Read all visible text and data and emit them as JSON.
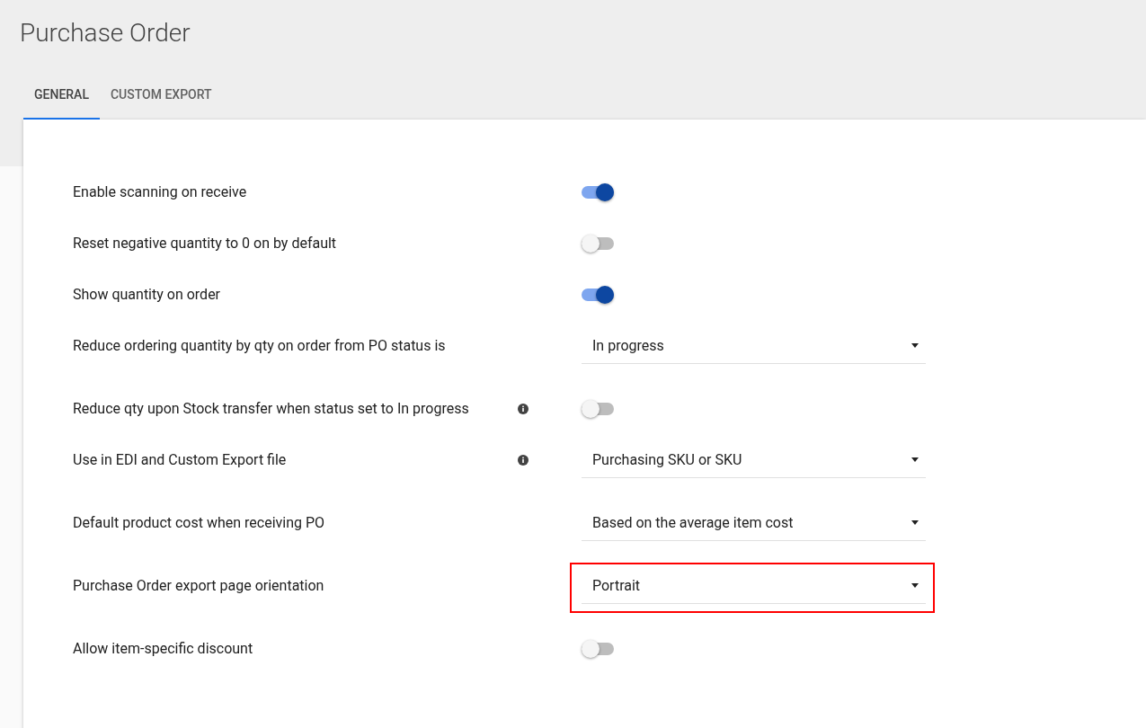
{
  "page": {
    "title": "Purchase Order"
  },
  "tabs": [
    {
      "label": "GENERAL",
      "selected": true
    },
    {
      "label": "CUSTOM EXPORT",
      "selected": false
    }
  ],
  "settings": [
    {
      "kind": "toggle",
      "label": "Enable scanning on receive",
      "on": true,
      "info": false
    },
    {
      "kind": "toggle",
      "label": "Reset negative quantity to 0 on by default",
      "on": false,
      "info": false
    },
    {
      "kind": "toggle",
      "label": "Show quantity on order",
      "on": true,
      "info": false
    },
    {
      "kind": "select",
      "label": "Reduce ordering quantity by qty on order from PO status is",
      "value": "In progress",
      "info": false,
      "highlighted": false
    },
    {
      "kind": "toggle",
      "label": "Reduce qty upon Stock transfer when status set to In progress",
      "on": false,
      "info": true
    },
    {
      "kind": "select",
      "label": "Use in EDI and Custom Export file",
      "value": "Purchasing SKU or SKU",
      "info": true,
      "highlighted": false
    },
    {
      "kind": "select",
      "label": "Default product cost when receiving PO",
      "value": "Based on the average item cost",
      "info": false,
      "highlighted": false
    },
    {
      "kind": "select",
      "label": "Purchase Order export page orientation",
      "value": "Portrait",
      "info": false,
      "highlighted": true
    },
    {
      "kind": "toggle",
      "label": "Allow item-specific discount",
      "on": false,
      "info": false
    }
  ]
}
